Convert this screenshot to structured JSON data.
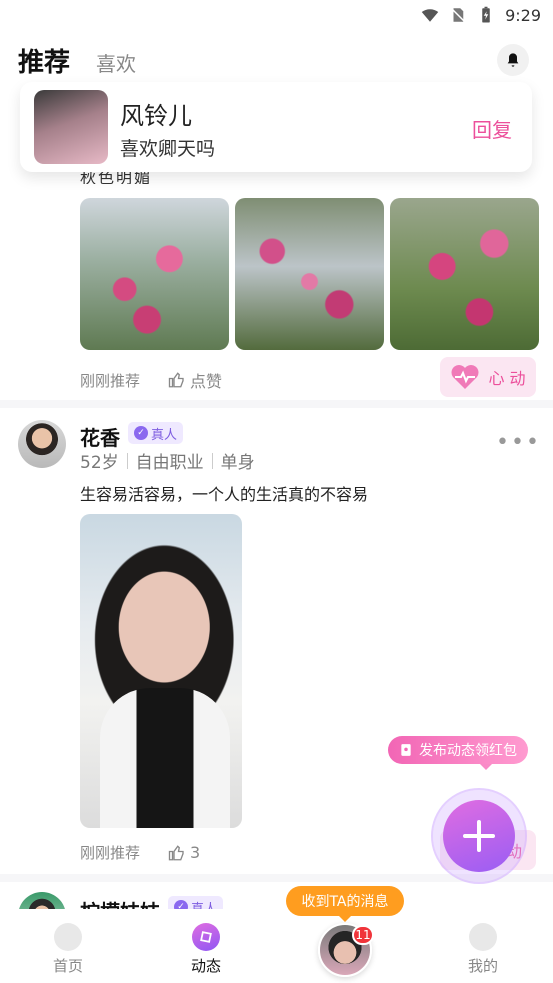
{
  "status_bar": {
    "time": "9:29",
    "icons": [
      "wifi-icon",
      "no-sim-icon",
      "battery-charging-icon"
    ]
  },
  "header": {
    "tab_active": "推荐",
    "tab_inactive": "喜欢",
    "bell_icon": "bell-icon"
  },
  "notification": {
    "name": "风铃儿",
    "message": "喜欢卿天吗",
    "reply_label": "回复"
  },
  "post1": {
    "clipped_text": "秋色明媚",
    "time_label": "刚刚推荐",
    "like_label": "点赞",
    "heart_label": "心 动"
  },
  "post2": {
    "name": "花香",
    "badge": "真人",
    "age": "52岁",
    "job": "自由职业",
    "status": "单身",
    "text": "生容易活容易，一个人的生活真的不容易",
    "time_label": "刚刚推荐",
    "likes": "3",
    "heart_label": "动"
  },
  "post3": {
    "name": "柠檬妹妹",
    "badge": "真人"
  },
  "floating": {
    "promo_label": "发布动态领红包",
    "tip_label": "收到TA的消息"
  },
  "bottom_nav": {
    "home": "首页",
    "moments": "动态",
    "mine": "我的",
    "unread_count": "11"
  },
  "colors": {
    "accent_pink": "#ec4f9b",
    "accent_purple": "#9a5df4",
    "tip_orange": "#ff9d1f",
    "badge_red": "#f0343a"
  }
}
